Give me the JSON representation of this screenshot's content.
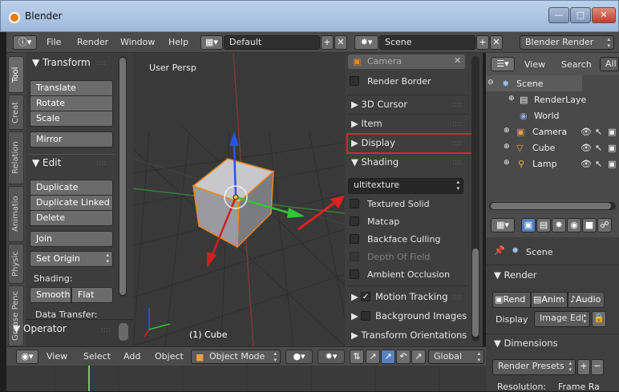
{
  "window": {
    "title": "Blender"
  },
  "topbar": {
    "menus": [
      "File",
      "Render",
      "Window",
      "Help"
    ],
    "layout": "Default",
    "scene": "Scene",
    "engine": "Blender Render"
  },
  "tabs": [
    "Tool",
    "Creat",
    "Relation",
    "Animatio",
    "Physic",
    "Grease Penc"
  ],
  "toolshelf": {
    "transform_title": "Transform",
    "transform_buttons": [
      "Translate",
      "Rotate",
      "Scale"
    ],
    "mirror": "Mirror",
    "edit_title": "Edit",
    "edit_buttons": [
      "Duplicate",
      "Duplicate Linked",
      "Delete"
    ],
    "join": "Join",
    "set_origin": "Set Origin",
    "shading_label": "Shading:",
    "smooth": "Smooth",
    "flat": "Flat",
    "data_transfer": "Data Transfer:",
    "operator_title": "Operator"
  },
  "viewport": {
    "view_label": "User Persp",
    "object_label": "(1) Cube"
  },
  "npanel": {
    "camera": "Camera",
    "render_border": "Render Border",
    "cursor": "3D Cursor",
    "item": "Item",
    "display": "Display",
    "shading": "Shading",
    "shading_mode": "ultitexture",
    "shading_options": [
      "Textured Solid",
      "Matcap",
      "Backface Culling",
      "Depth Of Field",
      "Ambient Occlusion"
    ],
    "motion_tracking": "Motion Tracking",
    "background_images": "Background Images",
    "transform_orientations": "Transform Orientations"
  },
  "outliner": {
    "view": "View",
    "search": "Search",
    "all": "All",
    "items": [
      "Scene",
      "RenderLaye",
      "World",
      "Camera",
      "Cube",
      "Lamp"
    ]
  },
  "properties": {
    "scene_label": "Scene",
    "render_title": "Render",
    "render_tabs": [
      "Rend",
      "Anim",
      "Audio"
    ],
    "display_label": "Display",
    "display_value": "Image Edi",
    "dimensions_title": "Dimensions",
    "render_presets": "Render Presets",
    "resolution_label": "Resolution:",
    "frame_rate_label": "Frame Ra"
  },
  "bottombar": {
    "menus": [
      "View",
      "Select",
      "Add",
      "Object"
    ],
    "mode": "Object Mode",
    "orientation": "Global"
  },
  "colors": {
    "highlight_box": "#d9272e",
    "annotation_arrow": "#e0231d",
    "axis_x": "#d02020",
    "axis_y": "#36c336",
    "axis_z": "#2b54e8",
    "accent_blue": "#5680c2",
    "timeline_frame": "#65d63a"
  }
}
